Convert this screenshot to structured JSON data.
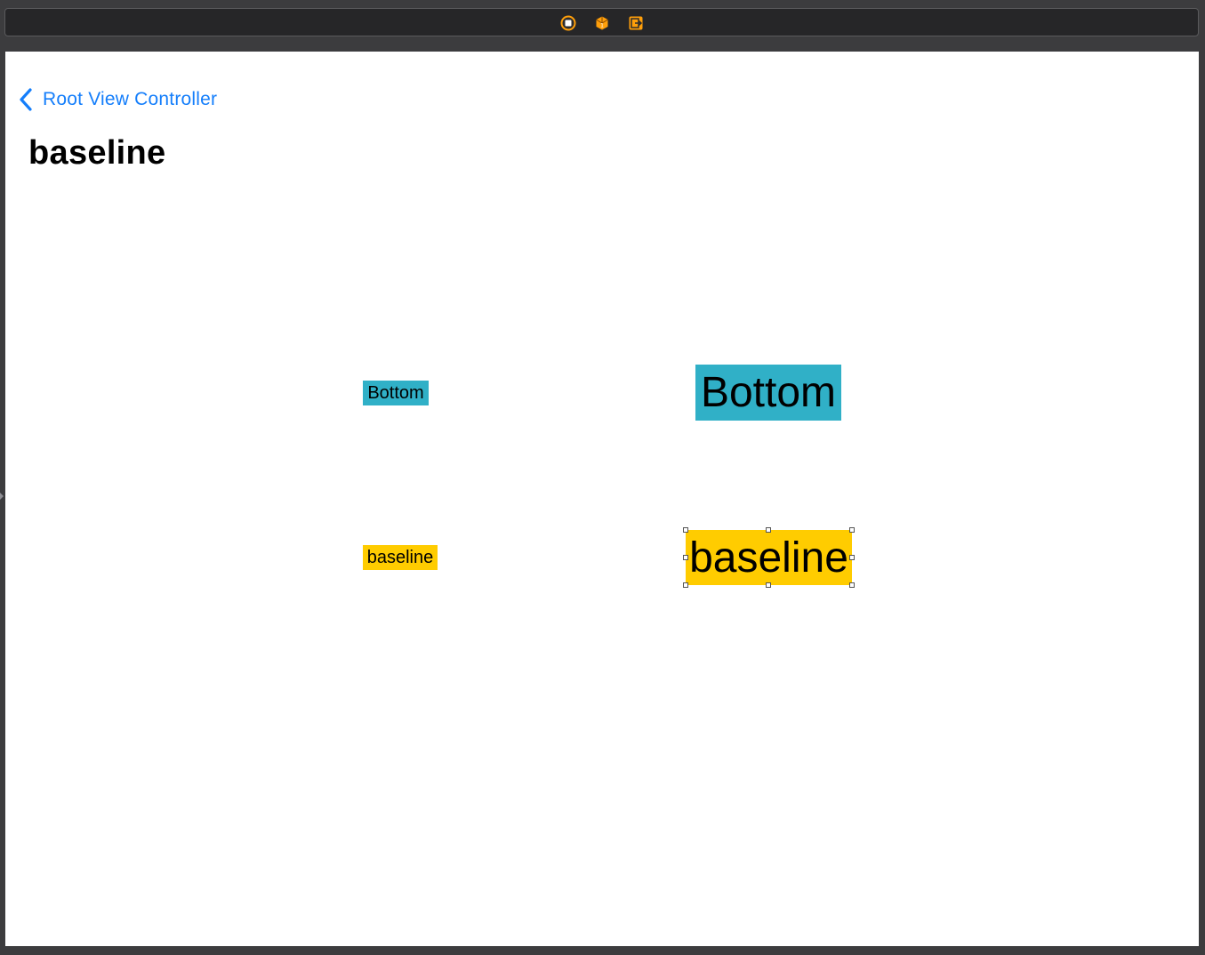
{
  "scene_dock": {
    "icons": [
      "view-controller-icon",
      "first-responder-icon",
      "exit-icon"
    ],
    "accent": "#ff9f0a"
  },
  "navigation": {
    "back_label": "Root View Controller",
    "title": "baseline",
    "tint": "#147efb"
  },
  "labels": {
    "small_bottom": "Bottom",
    "small_baseline": "baseline",
    "big_bottom": "Bottom",
    "big_baseline": "baseline"
  },
  "colors": {
    "teal": "#30b0c7",
    "yellow": "#ffcc00"
  }
}
